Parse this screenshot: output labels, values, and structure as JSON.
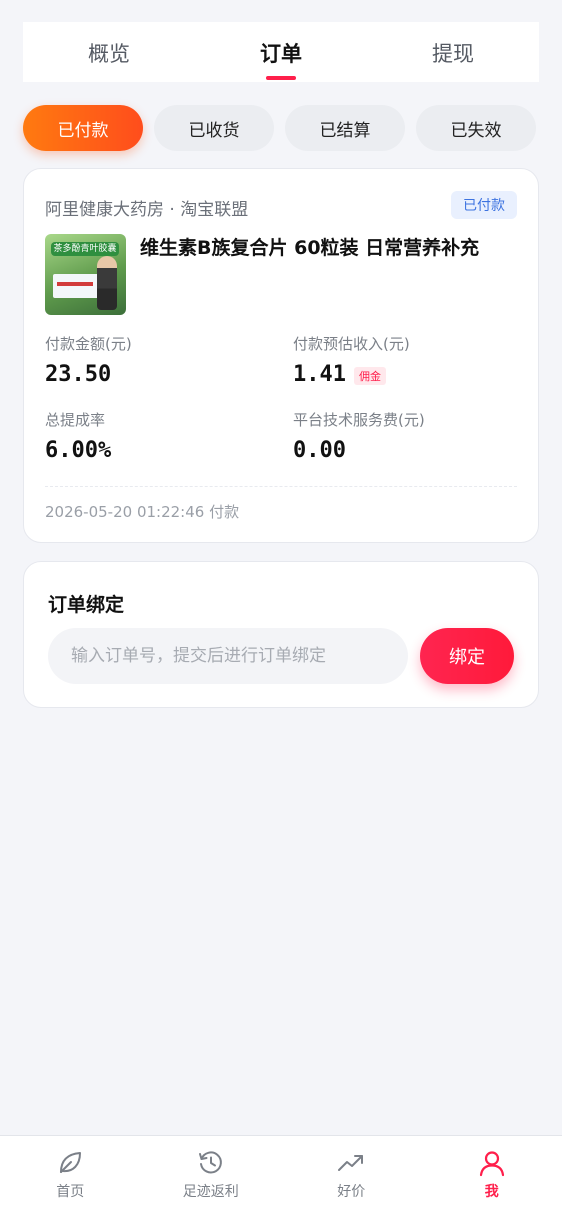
{
  "top_tabs": [
    "概览",
    "订单",
    "提现"
  ],
  "active_top_tab": "订单",
  "filters": [
    "已付款",
    "已收货",
    "已结算",
    "已失效"
  ],
  "active_filter": "已付款",
  "order": {
    "shop": "阿里健康大药房 · 淘宝联盟",
    "status": "已付款",
    "product_image_text": "茶多酚青叶胶囊",
    "product_title": "维生素B族复合片 60粒装 日常营养补充",
    "amount_label": "付款金额(元)",
    "amount_value": "23.50",
    "income_label": "付款预估收入(元)",
    "income_value": "1.41",
    "commission_tag": "佣金",
    "rate_label": "总提成率",
    "rate_value": "6.00%",
    "fee_label": "平台技术服务费(元)",
    "fee_value": "0.00",
    "paid_time": "2026-05-20 01:22:46 付款"
  },
  "bind": {
    "title": "订单绑定",
    "placeholder": "输入订单号，提交后进行订单绑定",
    "button": "绑定"
  },
  "bottom_nav": [
    {
      "label": "首页",
      "icon": "leaf-icon"
    },
    {
      "label": "足迹返利",
      "icon": "history-icon"
    },
    {
      "label": "好价",
      "icon": "trend-icon"
    },
    {
      "label": "我",
      "icon": "user-icon"
    }
  ],
  "active_nav": "我",
  "colors": {
    "accent": "#ff1f4b",
    "orange": "#ff6a14",
    "badge_blue": "#3d73e0"
  }
}
